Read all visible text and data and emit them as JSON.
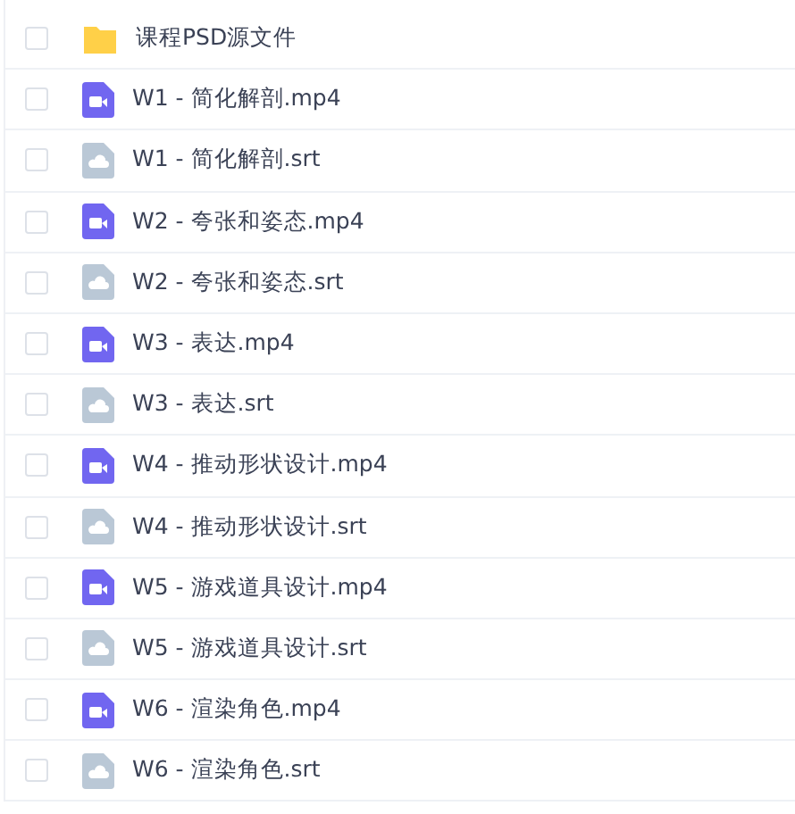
{
  "files": [
    {
      "kind": "folder",
      "name": "课程PSD源文件",
      "checked": false
    },
    {
      "kind": "video",
      "name": "W1 - 简化解剖.mp4",
      "checked": false
    },
    {
      "kind": "subtitle",
      "name": "W1 - 简化解剖.srt",
      "checked": false
    },
    {
      "kind": "video",
      "name": "W2 - 夸张和姿态.mp4",
      "checked": false
    },
    {
      "kind": "subtitle",
      "name": "W2 - 夸张和姿态.srt",
      "checked": false
    },
    {
      "kind": "video",
      "name": "W3 - 表达.mp4",
      "checked": false
    },
    {
      "kind": "subtitle",
      "name": "W3 - 表达.srt",
      "checked": false
    },
    {
      "kind": "video",
      "name": "W4 - 推动形状设计.mp4",
      "checked": false
    },
    {
      "kind": "subtitle",
      "name": "W4 - 推动形状设计.srt",
      "checked": false
    },
    {
      "kind": "video",
      "name": "W5 - 游戏道具设计.mp4",
      "checked": false
    },
    {
      "kind": "subtitle",
      "name": "W5 - 游戏道具设计.srt",
      "checked": false
    },
    {
      "kind": "video",
      "name": "W6 - 渲染角色.mp4",
      "checked": false
    },
    {
      "kind": "subtitle",
      "name": "W6 - 渲染角色.srt",
      "checked": false
    }
  ]
}
